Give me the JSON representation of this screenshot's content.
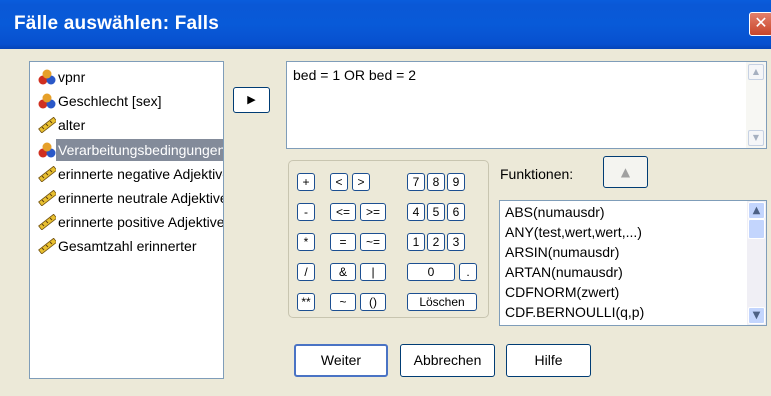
{
  "window": {
    "title": "Fälle auswählen: Falls",
    "close_glyph": "✕"
  },
  "variables": [
    {
      "label": "vpnr",
      "icon": "nominal-icon"
    },
    {
      "label": "Geschlecht [sex]",
      "icon": "nominal-icon"
    },
    {
      "label": "alter",
      "icon": "scale-icon"
    },
    {
      "label": "Verarbeitungsbedingungen",
      "icon": "nominal-icon",
      "selected": true
    },
    {
      "label": "erinnerte negative Adjektive",
      "icon": "scale-icon"
    },
    {
      "label": "erinnerte neutrale Adjektive",
      "icon": "scale-icon"
    },
    {
      "label": "erinnerte positive Adjektive",
      "icon": "scale-icon"
    },
    {
      "label": "Gesamtzahl erinnerter",
      "icon": "scale-icon"
    }
  ],
  "move_button": "▶",
  "expression": {
    "value": "bed = 1 OR bed = 2"
  },
  "keypad": {
    "row1": [
      "+",
      "<",
      ">",
      "7",
      "8",
      "9"
    ],
    "row2": [
      "-",
      "<=",
      ">=",
      "4",
      "5",
      "6"
    ],
    "row3": [
      "*",
      "=",
      "~=",
      "1",
      "2",
      "3"
    ],
    "row4": [
      "/",
      "&",
      "|",
      "0",
      "."
    ],
    "row5": [
      "**",
      "~",
      "()",
      "Löschen"
    ]
  },
  "functions": {
    "label": "Funktionen:",
    "up_glyph": "▲",
    "items": [
      "ABS(numausdr)",
      "ANY(test,wert,wert,...)",
      "ARSIN(numausdr)",
      "ARTAN(numausdr)",
      "CDFNORM(zwert)",
      "CDF.BERNOULLI(q,p)"
    ]
  },
  "buttons": {
    "weiter": "Weiter",
    "abbrechen": "Abbrechen",
    "hilfe": "Hilfe"
  },
  "colors": {
    "title_bar": "#0a5ddc",
    "selection": "#838b9a",
    "dialog_bg": "#ece9d8"
  }
}
